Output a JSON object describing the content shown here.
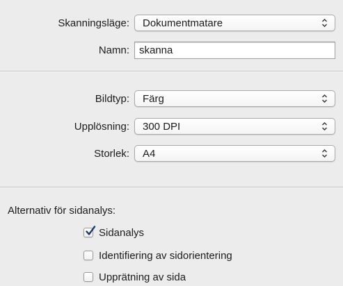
{
  "scan_mode": {
    "label": "Skanningsläge:",
    "value": "Dokumentmatare",
    "arrows_icon": "updown-chevrons-icon"
  },
  "name": {
    "label": "Namn:",
    "value": "skanna"
  },
  "image_type": {
    "label": "Bildtyp:",
    "value": "Färg",
    "arrows_icon": "updown-chevrons-icon"
  },
  "resolution": {
    "label": "Upplösning:",
    "value": "300 DPI",
    "arrows_icon": "updown-chevrons-icon"
  },
  "size": {
    "label": "Storlek:",
    "value": "A4",
    "arrows_icon": "updown-chevrons-icon"
  },
  "page_analysis": {
    "title": "Alternativ för sidanalys:",
    "options": [
      {
        "label": "Sidanalys",
        "checked": true
      },
      {
        "label": "Identifiering av sidorientering",
        "checked": false
      },
      {
        "label": "Upprätning av sida",
        "checked": false
      }
    ]
  },
  "colors": {
    "background": "#ececec",
    "checkmark": "#1f3a73"
  }
}
